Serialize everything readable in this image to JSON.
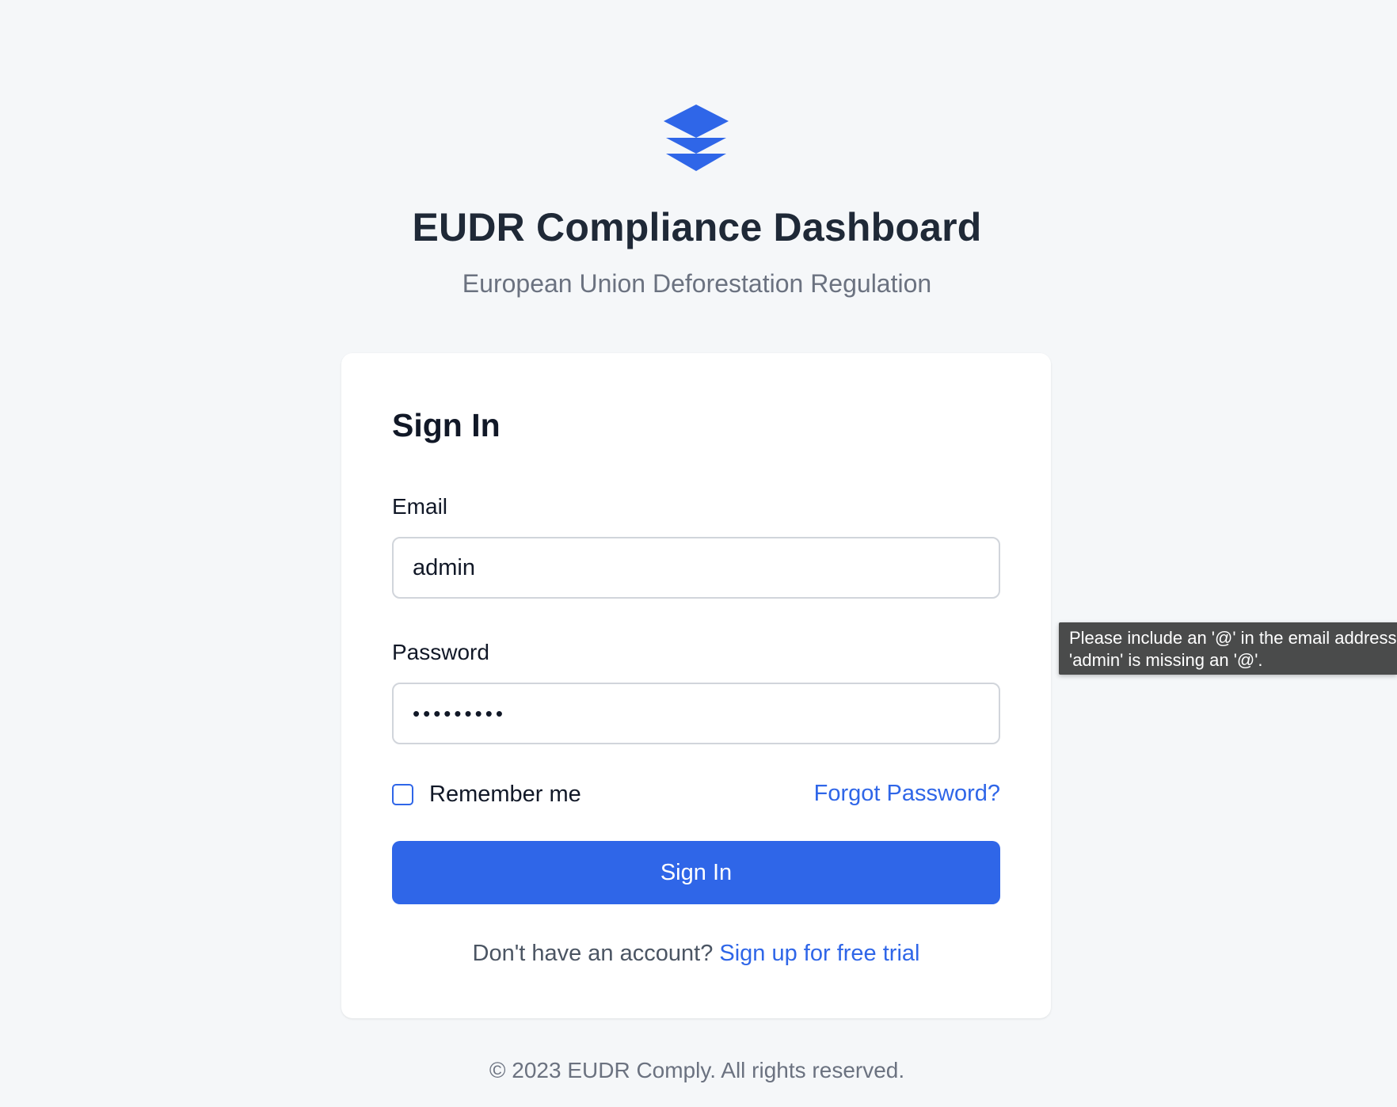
{
  "app": {
    "title": "EUDR Compliance Dashboard",
    "subtitle": "European Union Deforestation Regulation",
    "logo_icon": "layers-icon",
    "accent_color": "#2f66e8"
  },
  "signin_form": {
    "heading": "Sign In",
    "email_label": "Email",
    "email_value": "admin",
    "password_label": "Password",
    "password_value": "password1",
    "remember_label": "Remember me",
    "remember_checked": false,
    "forgot_link": "Forgot Password?",
    "submit_label": "Sign In",
    "signup_prompt": "Don't have an account?",
    "signup_link": "Sign up for free trial"
  },
  "validation_tooltip": {
    "line1": "Please include an '@' in the email address.",
    "line2": "'admin' is missing an '@'."
  },
  "footer": {
    "copyright": "© 2023 EUDR Comply. All rights reserved."
  }
}
